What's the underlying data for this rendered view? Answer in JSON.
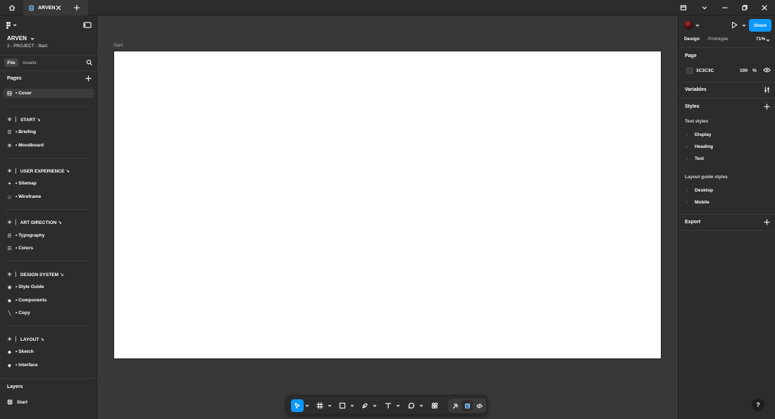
{
  "titlebar": {
    "tab_label": "ARVEN"
  },
  "left": {
    "project_name": "ARVEN",
    "project_path": "2 - PROJECT - Start",
    "tabs": {
      "file": "File",
      "assets": "Assets"
    },
    "pages_title": "Pages",
    "pages": [
      {
        "label": "▪ Cover",
        "icon": "page-cover-icon",
        "selected": true
      },
      {
        "label": "▏ START ↘",
        "icon": "asterisk-icon"
      },
      {
        "label": "• Briefing",
        "icon": "text-lines-icon"
      },
      {
        "label": "• Moodboard",
        "icon": "asterisk-icon"
      },
      {
        "label": "▏ USER EXPERIENCE ↘",
        "icon": "asterisk-icon"
      },
      {
        "label": "• Sitemap",
        "icon": "sparkle-icon"
      },
      {
        "label": "• Wireframe",
        "icon": "diamond-outline-icon"
      },
      {
        "label": "▏ ART DIRECTION ↘",
        "icon": "asterisk-icon"
      },
      {
        "label": "• Typography",
        "icon": "text-lines-icon"
      },
      {
        "label": "• Colors",
        "icon": "text-lines-icon"
      },
      {
        "label": "▏ DESIGN SYSTEM ↘",
        "icon": "asterisk-icon"
      },
      {
        "label": "• Style Guide",
        "icon": "circle-dot-icon"
      },
      {
        "label": "• Components",
        "icon": "diamond-icon"
      },
      {
        "label": "• Copy",
        "icon": "pen-line-icon"
      },
      {
        "label": "▏ LAYOUT ↘",
        "icon": "asterisk-icon"
      },
      {
        "label": "• Sketch",
        "icon": "diamond-icon"
      },
      {
        "label": "• Interface",
        "icon": "diamond-icon"
      }
    ],
    "layers_title": "Layers",
    "layers": [
      {
        "label": "Start",
        "icon": "frame-icon"
      }
    ]
  },
  "canvas": {
    "frame_label": "Start",
    "frame_fill": "#ffffff",
    "canvas_bg": "#383838"
  },
  "toolbar": {
    "tools": [
      "move-tool",
      "frame-tool",
      "rectangle-tool",
      "pen-tool",
      "text-tool",
      "comment-tool",
      "actions-tool"
    ],
    "active_tool": "move-tool",
    "modes": [
      "draw-mode",
      "design-mode",
      "dev-mode"
    ],
    "active_mode": "design-mode"
  },
  "right": {
    "tabs": {
      "design": "Design",
      "prototype": "Prototype"
    },
    "zoom": "71%",
    "share_label": "Share",
    "page_title": "Page",
    "page_color": "3C3C3C",
    "page_opacity": "100",
    "page_opacity_unit": "%",
    "variables_title": "Variables",
    "styles_title": "Styles",
    "text_styles_title": "Text styles",
    "text_styles": [
      "Display",
      "Heading",
      "Text"
    ],
    "layout_styles_title": "Layout guide styles",
    "layout_styles": [
      "Desktop",
      "Mobile"
    ],
    "export_title": "Export",
    "accent": "#0d99ff"
  },
  "help_label": "?"
}
